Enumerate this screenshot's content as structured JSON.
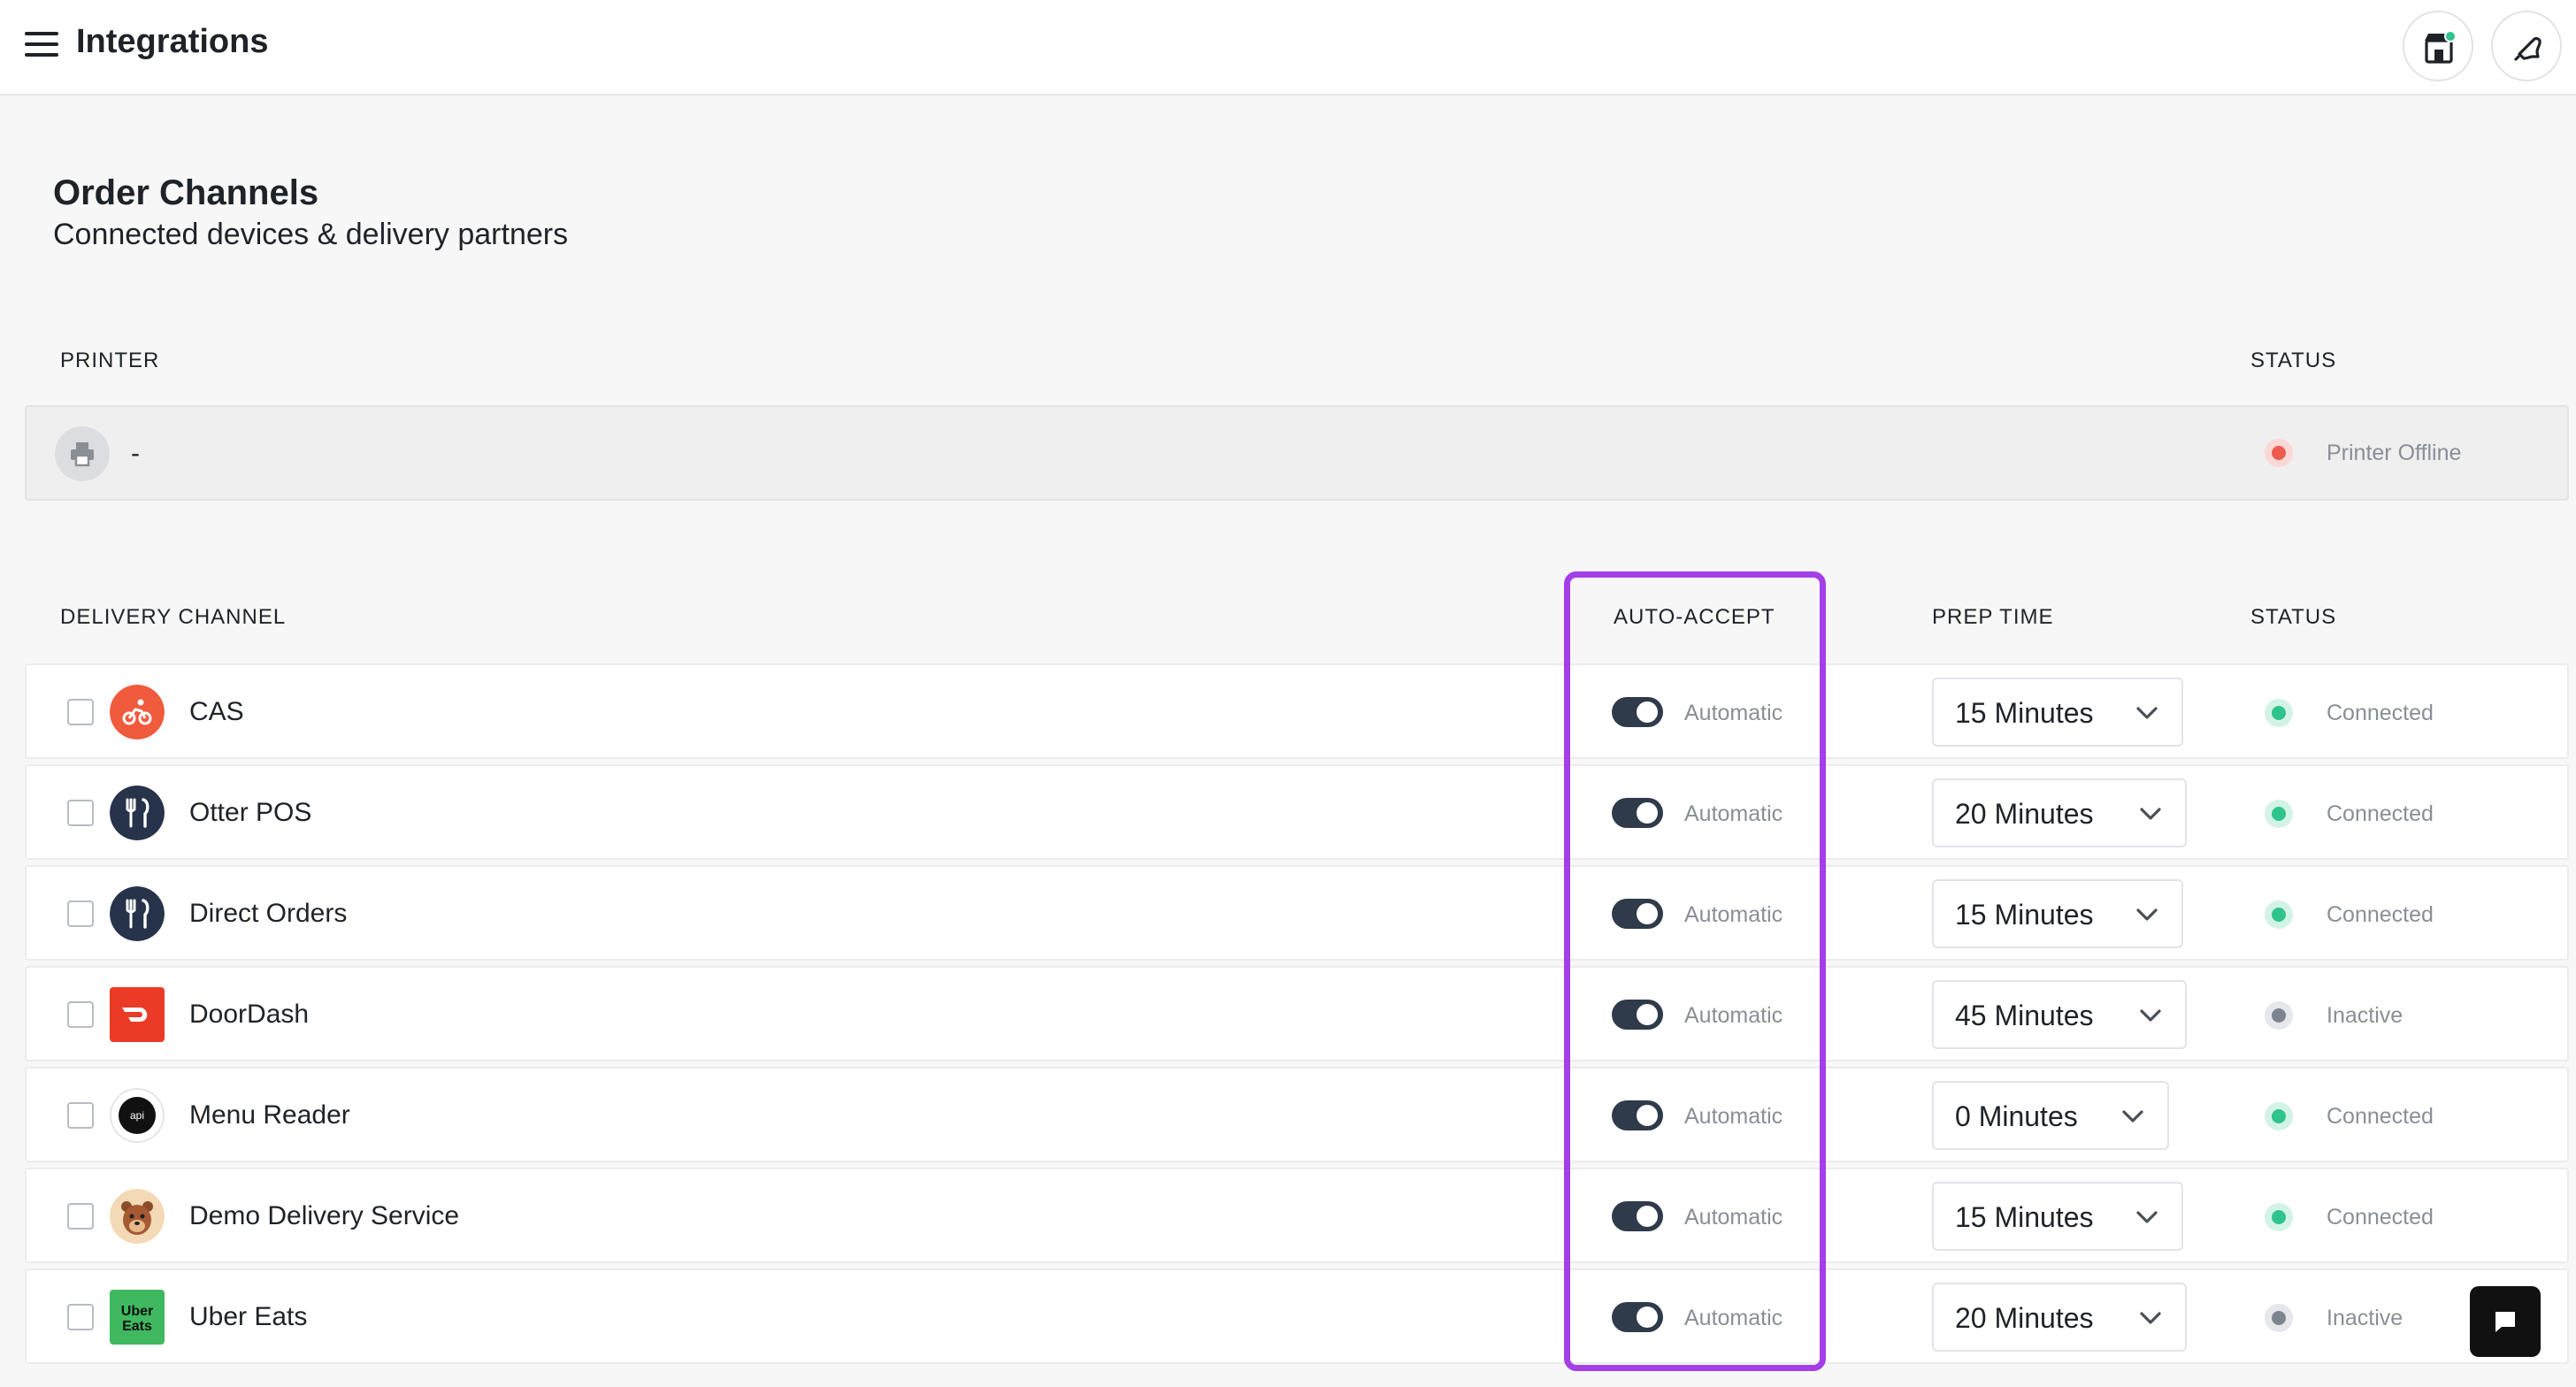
{
  "header": {
    "title": "Integrations",
    "icons": {
      "menu": "hamburger-menu-icon",
      "store": "store-icon",
      "notifications": "bell-icon"
    },
    "store_badge_color": "#2fc38d"
  },
  "section": {
    "title": "Order Channels",
    "subtitle": "Connected devices & delivery partners"
  },
  "printer_table": {
    "headers": {
      "printer": "PRINTER",
      "status": "STATUS"
    },
    "row": {
      "name": "-",
      "status": "Printer Offline",
      "status_color": "#ef5b4f",
      "icon": "printer-icon"
    }
  },
  "delivery_table": {
    "headers": {
      "channel": "DELIVERY CHANNEL",
      "auto_accept": "AUTO-ACCEPT",
      "prep_time": "PREP TIME",
      "status": "STATUS"
    },
    "rows": [
      {
        "name": "CAS",
        "auto_accept_label": "Automatic",
        "auto_accept_on": true,
        "prep_time": "15 Minutes",
        "status": "Connected",
        "logo": "cas-bike-icon"
      },
      {
        "name": "Otter POS",
        "auto_accept_label": "Automatic",
        "auto_accept_on": true,
        "prep_time": "20 Minutes",
        "status": "Connected",
        "logo": "fork-knife-icon"
      },
      {
        "name": "Direct Orders",
        "auto_accept_label": "Automatic",
        "auto_accept_on": true,
        "prep_time": "15 Minutes",
        "status": "Connected",
        "logo": "fork-knife-icon"
      },
      {
        "name": "DoorDash",
        "auto_accept_label": "Automatic",
        "auto_accept_on": true,
        "prep_time": "45 Minutes",
        "status": "Inactive",
        "logo": "doordash-logo-icon"
      },
      {
        "name": "Menu Reader",
        "auto_accept_label": "Automatic",
        "auto_accept_on": true,
        "prep_time": "0 Minutes",
        "status": "Connected",
        "logo": "api-logo-icon",
        "logo_text": "api"
      },
      {
        "name": "Demo Delivery Service",
        "auto_accept_label": "Automatic",
        "auto_accept_on": true,
        "prep_time": "15 Minutes",
        "status": "Connected",
        "logo": "bear-mascot-icon"
      },
      {
        "name": "Uber Eats",
        "auto_accept_label": "Automatic",
        "auto_accept_on": true,
        "prep_time": "20 Minutes",
        "status": "Inactive",
        "logo": "uber-eats-logo-icon",
        "logo_text_1": "Uber",
        "logo_text_2": "Eats"
      }
    ]
  },
  "colors": {
    "connected": "#2fc38d",
    "inactive": "#7d8490",
    "highlight": "#a43fe8",
    "toggle_on": "#2f3a4a",
    "cas_brand": "#ef5b3c",
    "doordash_brand": "#eb3b26",
    "ubereats_brand": "#3fb860"
  },
  "chat": {
    "icon": "chat-bubble-icon"
  }
}
